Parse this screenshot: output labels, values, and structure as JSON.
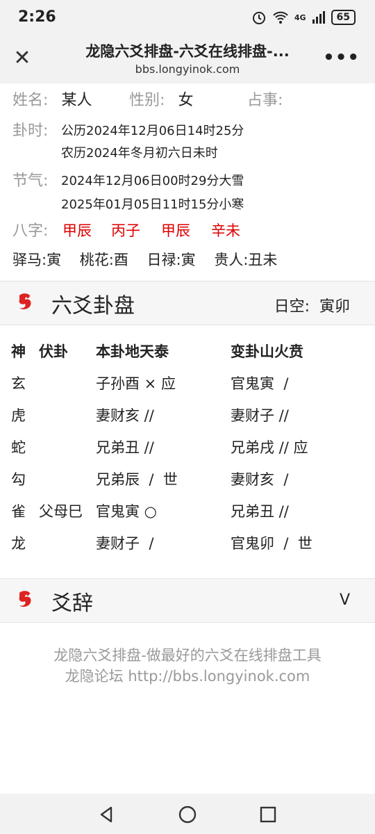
{
  "status": {
    "time": "2:26",
    "network": "4G",
    "battery": "65"
  },
  "header": {
    "title": "龙隐六爻排盘-六爻在线排盘-...",
    "url": "bbs.longyinok.com"
  },
  "info": {
    "name_label": "姓名:",
    "name_value": "某人",
    "gender_label": "性别:",
    "gender_value": "女",
    "matter_label": "占事:",
    "time_label": "卦时:",
    "time_solar": "公历2024年12月06日14时25分",
    "time_lunar": "农历2024年冬月初六日未时",
    "jieqi_label": "节气:",
    "jieqi_1": "2024年12月06日00时29分大雪",
    "jieqi_2": "2025年01月05日11时15分小寒",
    "bazi_label": "八字:",
    "bazi": [
      "甲辰",
      "丙子",
      "甲辰",
      "辛未"
    ],
    "shensha": "驿马:寅    桃花:酉    日禄:寅    贵人:丑未"
  },
  "section1": {
    "title": "六爻卦盘",
    "right": "日空:  寅卯"
  },
  "table": {
    "headers": [
      "神",
      "伏卦",
      "本卦地天泰",
      "变卦山火贲"
    ],
    "rows": [
      [
        "玄",
        "",
        "子孙酉 × 应",
        "官鬼寅  /"
      ],
      [
        "虎",
        "",
        "妻财亥 //",
        "妻财子 //"
      ],
      [
        "蛇",
        "",
        "兄弟丑 //",
        "兄弟戌 // 应"
      ],
      [
        "勾",
        "",
        "兄弟辰  /  世",
        "妻财亥  /"
      ],
      [
        "雀",
        "父母巳",
        "官鬼寅 ○",
        "兄弟丑 //"
      ],
      [
        "龙",
        "",
        "妻财子  /",
        "官鬼卯  /  世"
      ]
    ]
  },
  "section2": {
    "title": "爻辞",
    "toggle": "V"
  },
  "footer": {
    "line1": "龙隐六爻排盘-做最好的六爻在线排盘工具",
    "line2": "龙隐论坛 http://bbs.longyinok.com"
  },
  "colors": {
    "accent_red": "#d00000",
    "label_gray": "#999999"
  }
}
